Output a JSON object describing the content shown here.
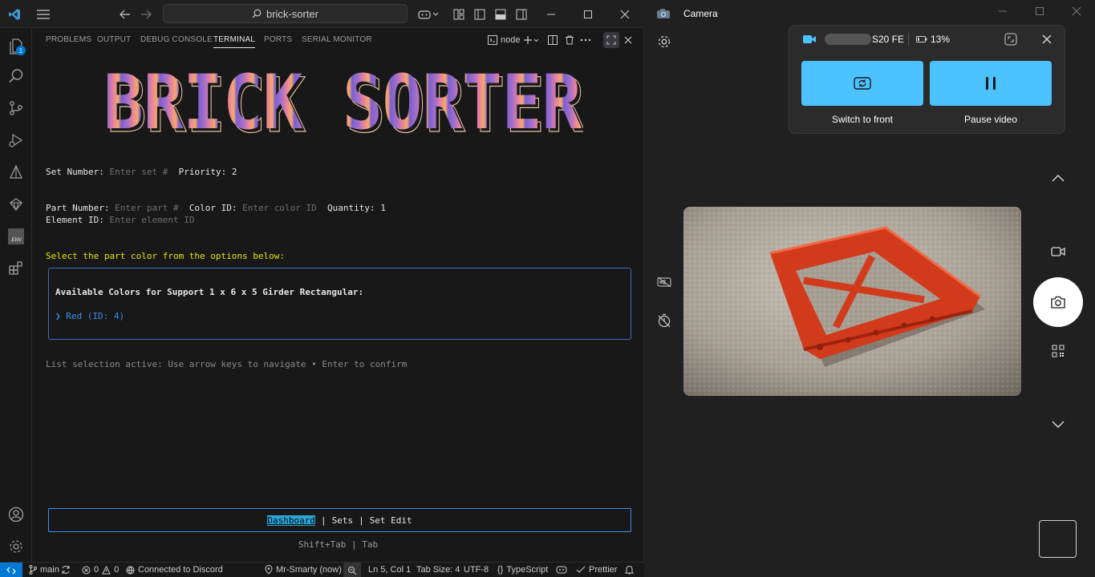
{
  "vscode": {
    "search_text": "brick-sorter",
    "activity_badge": "1",
    "env_label": ".ENV",
    "panel_tabs": [
      "PROBLEMS",
      "OUTPUT",
      "DEBUG CONSOLE",
      "TERMINAL",
      "PORTS",
      "SERIAL MONITOR"
    ],
    "active_tab": "TERMINAL",
    "terminal_name": "node",
    "terminal": {
      "banner": "BRICK SORTER",
      "set_number_label": "Set Number:",
      "set_number_placeholder": "Enter set #",
      "priority_label": "Priority:",
      "priority_value": "2",
      "part_number_label": "Part Number:",
      "part_number_placeholder": "Enter part #",
      "color_id_label": "Color ID:",
      "color_id_placeholder": "Enter color ID",
      "quantity_label": "Quantity:",
      "quantity_value": "1",
      "element_id_label": "Element ID:",
      "element_id_placeholder": "Enter element ID",
      "select_prompt": "Select the part color from the options below:",
      "colors_header": "Available Colors for Support 1 x 6 x 5 Girder Rectangular:",
      "color_option": "❯ Red (ID: 4)",
      "help_text": "List selection active: Use arrow keys to navigate • Enter to confirm",
      "nav": [
        "Dashboard",
        "Sets",
        "Set Edit"
      ],
      "nav_selected": "Dashboard",
      "nav_hint": "Shift+Tab | Tab"
    },
    "status": {
      "branch": "main",
      "errors": "0",
      "warnings": "0",
      "discord": "Connected to Discord",
      "user": "Mr-Smarty (now)",
      "position": "Ln 5, Col 1",
      "tab_size": "Tab Size: 4",
      "encoding": "UTF-8",
      "language": "TypeScript",
      "formatter": "Prettier"
    }
  },
  "camera": {
    "title": "Camera",
    "device_name": "S20 FE",
    "battery": "13%",
    "switch_label": "Switch to front",
    "pause_label": "Pause video"
  },
  "colors": {
    "accent_blue": "#0078d4",
    "terminal_yellow": "#e5e510",
    "terminal_blue": "#3b8eea",
    "camera_button": "#4cc2ff"
  }
}
